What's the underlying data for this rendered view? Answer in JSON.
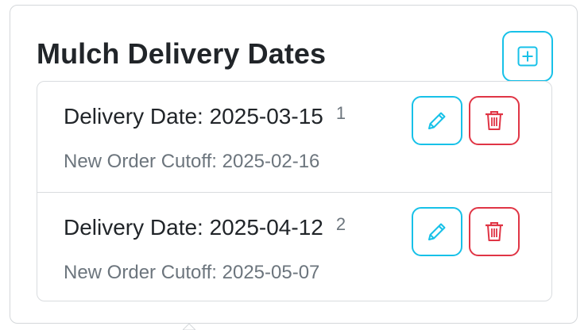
{
  "card": {
    "title": "Mulch Delivery Dates"
  },
  "icons": {
    "add": "plus-square-icon",
    "edit": "pencil-icon",
    "delete": "trash-icon"
  },
  "colors": {
    "info": "#17c1e8",
    "danger": "#e03545",
    "muted": "#6c757d"
  },
  "deliveries": [
    {
      "date_label": "Delivery Date: 2025-03-15",
      "badge": "1",
      "cutoff_label": "New Order Cutoff: 2025-02-16"
    },
    {
      "date_label": "Delivery Date: 2025-04-12",
      "badge": "2",
      "cutoff_label": "New Order Cutoff: 2025-05-07"
    }
  ]
}
